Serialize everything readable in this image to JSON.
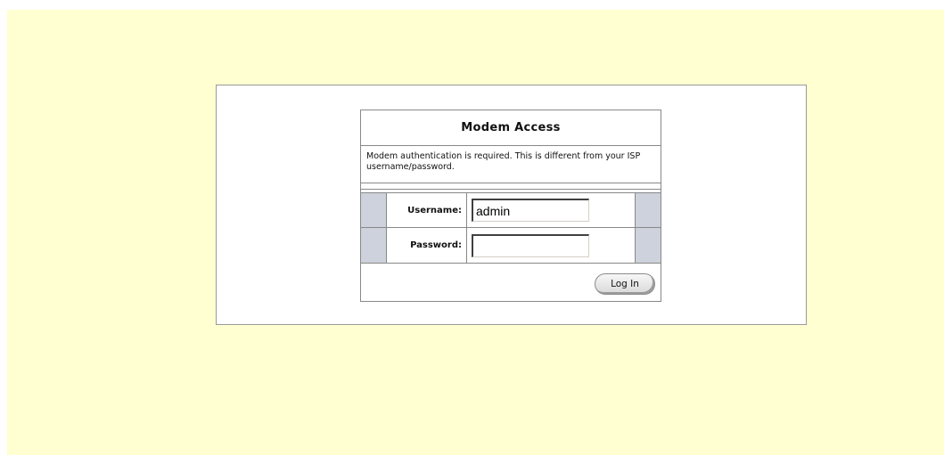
{
  "login": {
    "title": "Modem Access",
    "description": "Modem authentication is required. This is different from your ISP username/password.",
    "username_label": "Username:",
    "username_value": "admin",
    "password_label": "Password:",
    "password_value": "",
    "login_button_label": "Log In"
  },
  "colors": {
    "page_background": "#ffffd1",
    "panel_background": "#ffffff",
    "side_cell": "#cdd2dc"
  }
}
